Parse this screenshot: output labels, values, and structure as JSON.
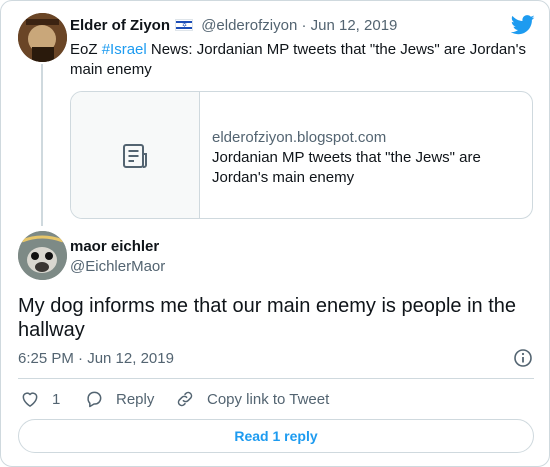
{
  "quoted": {
    "name": "Elder of Ziyon",
    "handle": "@elderofziyon",
    "separator": " · ",
    "date": "Jun 12, 2019",
    "text_prefix": "EoZ ",
    "hashtag": "#Israel",
    "text_rest": " News: Jordanian MP tweets that \"the Jews\" are Jordan's main enemy",
    "link": {
      "domain": "elderofziyon.blogspot.com",
      "title": "Jordanian MP tweets that \"the Jews\" are Jordan's main enemy"
    }
  },
  "tweet": {
    "name": "maor eichler",
    "handle": "@EichlerMaor",
    "text": "My dog informs me that our main enemy is people in the hallway",
    "time": "6:25 PM · Jun 12, 2019"
  },
  "actions": {
    "like_count": "1",
    "reply_label": "Reply",
    "copy_label": "Copy link to Tweet"
  },
  "read_replies_label": "Read 1 reply",
  "icons": {
    "brand": "twitter-bird-icon",
    "flag": "israel-flag-icon",
    "link_card": "document-icon",
    "info": "info-icon",
    "like": "heart-icon",
    "reply": "reply-bubble-icon",
    "copy": "link-icon"
  },
  "colors": {
    "accent": "#1d9bf0",
    "muted": "#536471",
    "border": "#cfd9de"
  }
}
